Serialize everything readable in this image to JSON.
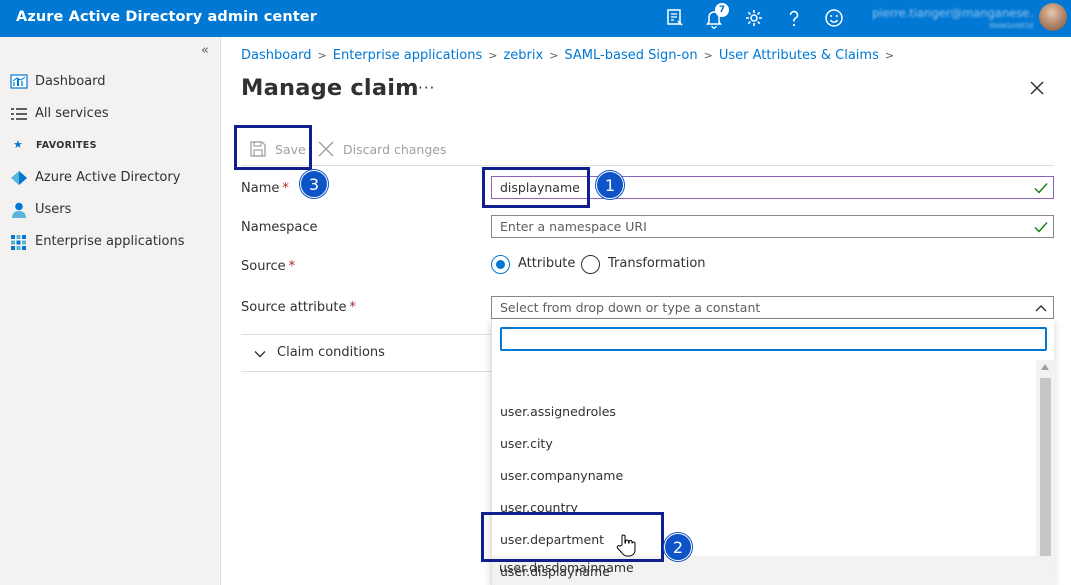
{
  "topbar": {
    "title": "Azure Active Directory admin center",
    "notification_count": "7",
    "user_email": "pierre.tianger@manganese...",
    "user_tenant": "MANGANESE",
    "icons": [
      "feedback-icon",
      "bell-icon",
      "gear-icon",
      "help-icon",
      "smiley-icon"
    ]
  },
  "sidebar": {
    "collapse_glyph": "«",
    "items": [
      {
        "label": "Dashboard",
        "icon": "dashboard-icon"
      },
      {
        "label": "All services",
        "icon": "list-icon"
      }
    ],
    "favorites_label": "FAVORITES",
    "favorites": [
      {
        "label": "Azure Active Directory",
        "icon": "aad-diamond-icon"
      },
      {
        "label": "Users",
        "icon": "user-icon"
      },
      {
        "label": "Enterprise applications",
        "icon": "grid-apps-icon"
      }
    ]
  },
  "breadcrumb": [
    "Dashboard",
    "Enterprise applications",
    "zebrix",
    "SAML-based Sign-on",
    "User Attributes & Claims"
  ],
  "page": {
    "title": "Manage claim",
    "more_glyph": "···"
  },
  "toolbar": {
    "save_label": "Save",
    "discard_label": "Discard changes"
  },
  "form": {
    "name_label": "Name",
    "name_value": "displayname",
    "namespace_label": "Namespace",
    "namespace_placeholder": "Enter a namespace URI",
    "source_label": "Source",
    "source_options": [
      "Attribute",
      "Transformation"
    ],
    "source_selected": "Attribute",
    "source_attribute_label": "Source attribute",
    "source_attribute_placeholder": "Select from drop down or type a constant",
    "required_mark": "*"
  },
  "claim_conditions_label": "Claim conditions",
  "dropdown": {
    "options": [
      "user.assignedroles",
      "user.city",
      "user.companyname",
      "user.country",
      "user.department",
      "user.displayname",
      "user.dnsdomainname"
    ],
    "hovered": "user.displayname"
  },
  "annotations": {
    "step1": "1",
    "step2": "2",
    "step3": "3",
    "color": "#0f1f8f"
  },
  "colors": {
    "brand": "#0078d4",
    "required": "#a4262c",
    "valid_check": "#107c10"
  }
}
